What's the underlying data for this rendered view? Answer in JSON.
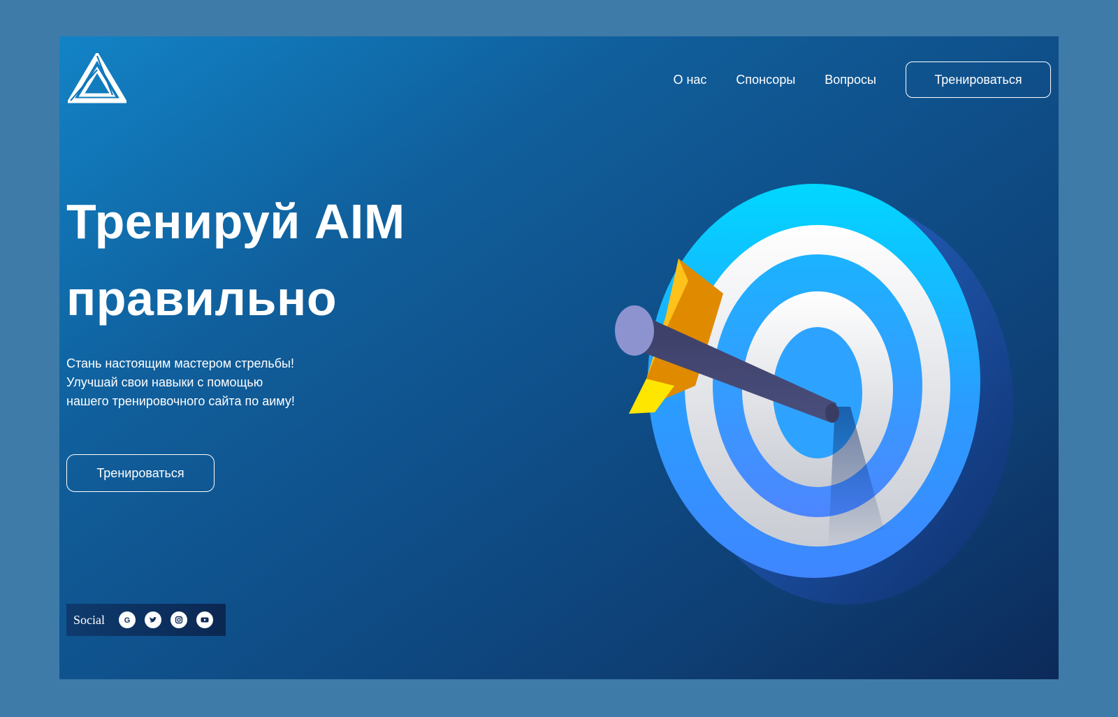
{
  "header": {
    "nav": [
      {
        "label": "О нас"
      },
      {
        "label": "Спонсоры"
      },
      {
        "label": "Вопросы"
      }
    ],
    "cta_label": "Тренироваться"
  },
  "hero": {
    "title_line1": "Тренируй AIM",
    "title_line2": "правильно",
    "subtitle_lines": [
      "Стань настоящим мастером стрельбы!",
      "Улучшай свои навыки с помощью",
      "нашего тренировочного сайта по аиму!"
    ],
    "button_label": "Тренироваться"
  },
  "social": {
    "label": "Social",
    "icons": [
      "google-icon",
      "twitter-icon",
      "instagram-icon",
      "youtube-icon"
    ]
  },
  "colors": {
    "background": "#3f7ba8",
    "panel_top": "#1283c6",
    "panel_bottom": "#0c2a5a",
    "text": "#ffffff",
    "arrow_fletching": "#f0a400",
    "target_blue": "#3f8cff",
    "target_cyan": "#00d4ff"
  }
}
